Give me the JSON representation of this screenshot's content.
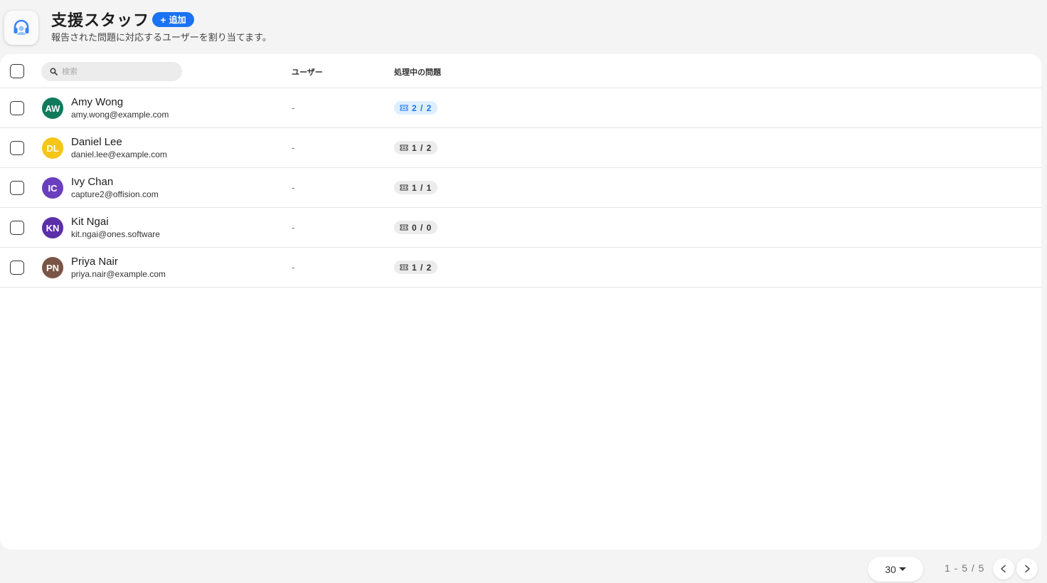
{
  "header": {
    "title": "支援スタッフ",
    "add_label": "追加",
    "subtitle": "報告された問題に対応するユーザーを割り当てます。",
    "app_icon": "headset-icon"
  },
  "table": {
    "search_placeholder": "検索",
    "columns": {
      "user": "ユーザー",
      "issues": "処理中の問題"
    },
    "rows": [
      {
        "initials": "AW",
        "name": "Amy Wong",
        "email": "amy.wong@example.com",
        "user": "-",
        "issues": "2 / 2",
        "avatar_color": "#0f7a5c",
        "highlight": true
      },
      {
        "initials": "DL",
        "name": "Daniel Lee",
        "email": "daniel.lee@example.com",
        "user": "-",
        "issues": "1 / 2",
        "avatar_color": "#f5c518",
        "highlight": false
      },
      {
        "initials": "IC",
        "name": "Ivy Chan",
        "email": "capture2@offision.com",
        "user": "-",
        "issues": "1 / 1",
        "avatar_color": "#6a3fbf",
        "highlight": false
      },
      {
        "initials": "KN",
        "name": "Kit Ngai",
        "email": "kit.ngai@ones.software",
        "user": "-",
        "issues": "0 / 0",
        "avatar_color": "#5b2fa8",
        "highlight": false
      },
      {
        "initials": "PN",
        "name": "Priya Nair",
        "email": "priya.nair@example.com",
        "user": "-",
        "issues": "1 / 2",
        "avatar_color": "#7a5545",
        "highlight": false
      }
    ]
  },
  "pagination": {
    "page_size": "30",
    "range": "1 - 5 / 5"
  },
  "colors": {
    "accent": "#1a73f0",
    "badge_active_bg": "#deeefc"
  }
}
